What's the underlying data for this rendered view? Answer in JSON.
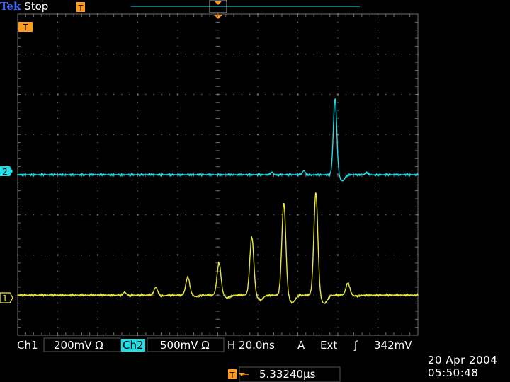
{
  "header": {
    "brand": "Tek",
    "run_state": "Stop"
  },
  "readouts": {
    "ch1_label": "Ch1",
    "ch1_scale": "200mV Ω",
    "ch2_label": "Ch2",
    "ch2_scale": "500mV Ω",
    "horizontal": "H 20.0ns",
    "trigger_channel": "A",
    "trigger_source": "Ext",
    "trigger_slope": "ʃ",
    "trigger_level": "342mV",
    "trigger_position": "5.33240µs",
    "date": "20 Apr 2004",
    "time": "05:50:48"
  },
  "markers": {
    "trigger_marker": "T",
    "ch2_marker": "2",
    "ch1_marker": "1"
  },
  "colors": {
    "ch1": "#e6e640",
    "ch2": "#22dde6",
    "trigger": "#ff9a1a",
    "graticule": "#6e6e6e",
    "brand": "#3b6cff"
  },
  "waveforms": {
    "ch1": {
      "baseline_div": 7.0,
      "pulses": [
        {
          "t_div": 2.67,
          "amp_div": 0.08,
          "w": 0.05
        },
        {
          "t_div": 3.45,
          "amp_div": 0.2,
          "w": 0.06
        },
        {
          "t_div": 4.25,
          "amp_div": 0.45,
          "w": 0.07
        },
        {
          "t_div": 5.03,
          "amp_div": 0.8,
          "w": 0.07
        },
        {
          "t_div": 5.85,
          "amp_div": 1.45,
          "w": 0.07
        },
        {
          "t_div": 6.65,
          "amp_div": 2.3,
          "w": 0.07
        },
        {
          "t_div": 7.45,
          "amp_div": 2.55,
          "w": 0.07
        },
        {
          "t_div": 8.25,
          "amp_div": 0.3,
          "w": 0.07
        }
      ]
    },
    "ch2": {
      "baseline_div": 4.0,
      "pulses": [
        {
          "t_div": 6.35,
          "amp_div": 0.06,
          "w": 0.05
        },
        {
          "t_div": 7.15,
          "amp_div": 0.1,
          "w": 0.05
        },
        {
          "t_div": 7.93,
          "amp_div": 1.9,
          "w": 0.06
        },
        {
          "t_div": 8.72,
          "amp_div": 0.05,
          "w": 0.06
        }
      ]
    }
  }
}
